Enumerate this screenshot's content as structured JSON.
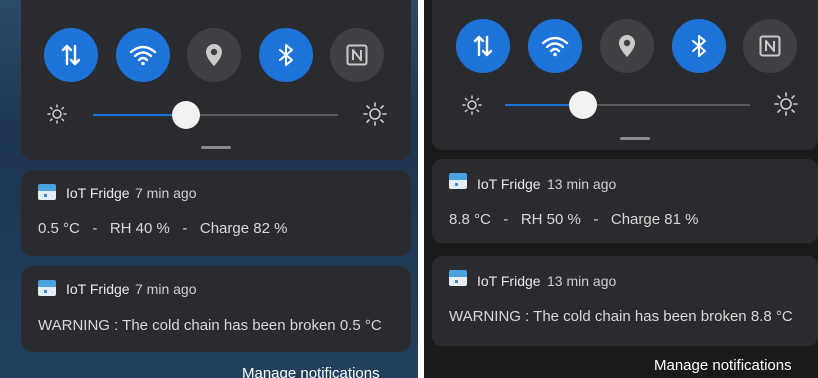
{
  "left": {
    "tiles": [
      {
        "icon": "mobile-data-icon",
        "state": "on"
      },
      {
        "icon": "wifi-icon",
        "state": "on"
      },
      {
        "icon": "location-icon",
        "state": "off"
      },
      {
        "icon": "bluetooth-icon",
        "state": "on"
      },
      {
        "icon": "nfc-icon",
        "state": "off"
      }
    ],
    "brightness": 0.38,
    "notifications": [
      {
        "app_name": "IoT Fridge",
        "time": "7 min ago",
        "body": "0.5 °C   -   RH 40 %   -   Charge 82 %"
      },
      {
        "app_name": "IoT Fridge",
        "time": "7 min ago",
        "body": "WARNING : The cold chain has been broken 0.5 °C"
      }
    ],
    "manage_label": "Manage notifications"
  },
  "right": {
    "tiles": [
      {
        "icon": "mobile-data-icon",
        "state": "on"
      },
      {
        "icon": "wifi-icon",
        "state": "on"
      },
      {
        "icon": "location-icon",
        "state": "off"
      },
      {
        "icon": "bluetooth-icon",
        "state": "on"
      },
      {
        "icon": "nfc-icon",
        "state": "off"
      }
    ],
    "brightness": 0.32,
    "notifications": [
      {
        "app_name": "IoT Fridge",
        "time": "13 min ago",
        "body": "8.8 °C   -   RH 50 %   -   Charge 81 %"
      },
      {
        "app_name": "IoT Fridge",
        "time": "13 min ago",
        "body": "WARNING : The cold chain has been broken 8.8 °C"
      }
    ],
    "manage_label": "Manage notifications"
  },
  "colors": {
    "accent": "#1e73d9",
    "tile_off": "#3f4044",
    "card": "#2a2b2f"
  }
}
